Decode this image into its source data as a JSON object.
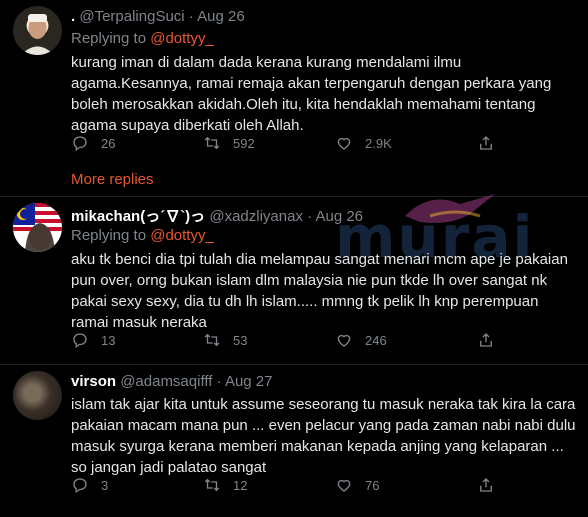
{
  "tweets": [
    {
      "name": ".",
      "handle": "@TerpalingSuci",
      "separator": "·",
      "time": "Aug 26",
      "replying_prefix": "Replying to",
      "replying_to": "@dottyy_",
      "body": "kurang iman di dalam dada kerana kurang mendalami ilmu agama.Kesannya, ramai remaja akan terpengaruh dengan perkara yang boleh merosakkan akidah.Oleh itu, kita hendaklah memahami tentang agama supaya diberkati oleh Allah.",
      "replies": "26",
      "retweets": "592",
      "likes": "2.9K"
    },
    {
      "name": "mikachan(っ´∇`)っ",
      "handle": "@xadzliyanax",
      "separator": "·",
      "time": "Aug 26",
      "replying_prefix": "Replying to",
      "replying_to": "@dottyy_",
      "body": "aku tk benci dia tpi tulah dia melampau sangat menari mcm ape je pakaian pun over, orng bukan islam dlm malaysia nie pun tkde lh over sangat nk pakai sexy sexy, dia tu dh lh islam..... mmng tk pelik lh knp perempuan ramai masuk neraka",
      "replies": "13",
      "retweets": "53",
      "likes": "246"
    },
    {
      "name": "virson",
      "handle": "@adamsaqifff",
      "separator": "·",
      "time": "Aug 27",
      "body": "islam tak ajar kita untuk assume seseorang tu masuk neraka tak kira la cara pakaian macam mana pun ... even pelacur yang pada zaman nabi nabi dulu masuk syurga kerana memberi makanan kepada anjing yang kelaparan ... so jangan jadi palatao sangat",
      "replies": "3",
      "retweets": "12",
      "likes": "76"
    }
  ],
  "more_replies": "More replies",
  "watermark": "murai",
  "icons": [
    "reply-icon",
    "retweet-icon",
    "like-icon",
    "share-icon"
  ],
  "colors": {
    "accent": "#e8572f",
    "muted": "#7f858b",
    "background": "#000000"
  }
}
